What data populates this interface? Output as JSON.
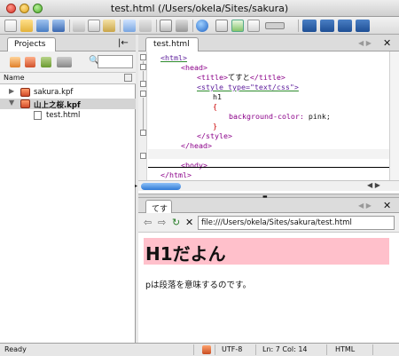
{
  "window": {
    "title": "test.html (/Users/okela/Sites/sakura)"
  },
  "left_panel": {
    "tab_label": "Projects",
    "column_header": "Name",
    "tree": [
      {
        "label": "sakura.kpf",
        "type": "project"
      },
      {
        "label": "山上之桜.kpf",
        "type": "project"
      },
      {
        "label": "test.html",
        "type": "file"
      }
    ]
  },
  "editor": {
    "tab_label": "test.html",
    "code_lines": [
      [
        "<html>"
      ],
      [
        "<head>"
      ],
      [
        "<title>",
        "てすと",
        "</title>"
      ],
      [
        "<style type=\"text/css\">"
      ],
      [
        "h1",
        "{"
      ],
      [
        "background-color:",
        " pink;"
      ],
      [
        "}"
      ],
      [
        "</style>"
      ],
      [
        "</head>"
      ],
      [
        ""
      ],
      [
        "<body>"
      ],
      [
        "</html>"
      ]
    ]
  },
  "preview": {
    "tab_label": "てすと",
    "url": "file:///Users/okela/Sites/sakura/test.html",
    "h1_text": "H1だよん",
    "p_text": "pは段落を意味するのです。"
  },
  "status": {
    "state": "Ready",
    "encoding": "UTF-8",
    "position": "Ln: 7 Col: 14",
    "language": "HTML"
  },
  "colors": {
    "h1_background": "#ffc0cb",
    "accent": "#2f7ad6",
    "tag": "#8b0089"
  }
}
